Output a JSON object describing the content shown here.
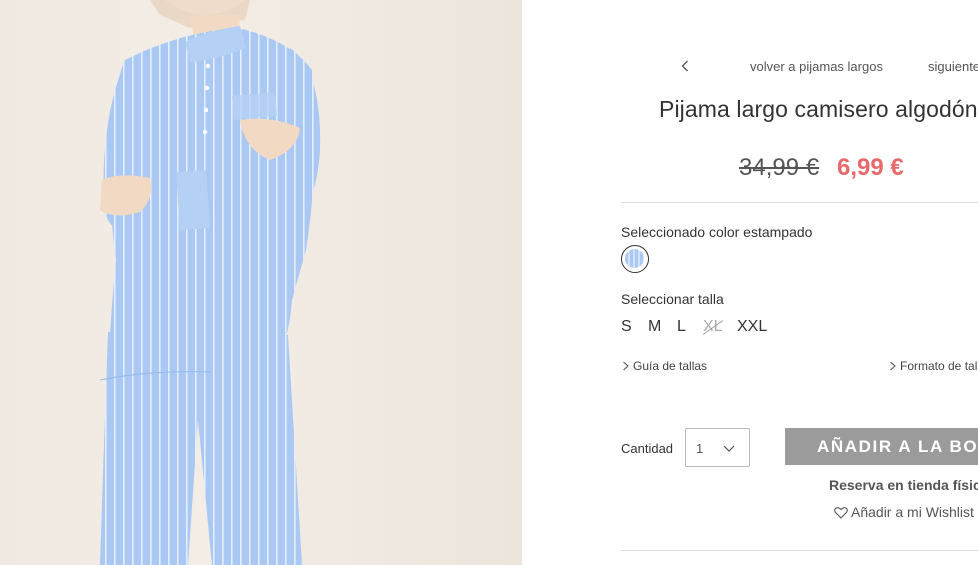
{
  "product_image": {
    "alt_icon": "product-photo",
    "background": "#efe9e1",
    "fabric_color": "#a9c8f3",
    "stripe_color": "#e4eefc"
  },
  "nav": {
    "back_label": "volver a pijamas largos",
    "next_label": "siguiente"
  },
  "product": {
    "title": "Pijama largo camisero algodón",
    "price_old": "34,99 €",
    "price_new": "6,99 €",
    "price_new_color": "#e8696b"
  },
  "color": {
    "label": "Seleccionado color estampado",
    "swatch_icon": "striped-blue-swatch"
  },
  "size": {
    "label": "Seleccionar talla",
    "options": [
      {
        "label": "S",
        "available": true
      },
      {
        "label": "M",
        "available": true
      },
      {
        "label": "L",
        "available": true
      },
      {
        "label": "XL",
        "available": false
      },
      {
        "label": "XXL",
        "available": true
      }
    ],
    "guide_label": "Guía de tallas",
    "format_label": "Formato de tallas"
  },
  "quantity": {
    "label": "Cantidad",
    "value": "1"
  },
  "actions": {
    "add_to_bag": "AÑADIR A LA BOLSA",
    "add_to_bag_color": "#9b9b9b",
    "reserve": "Reserva en tienda física",
    "wishlist": "Añadir a mi Wishlist"
  }
}
